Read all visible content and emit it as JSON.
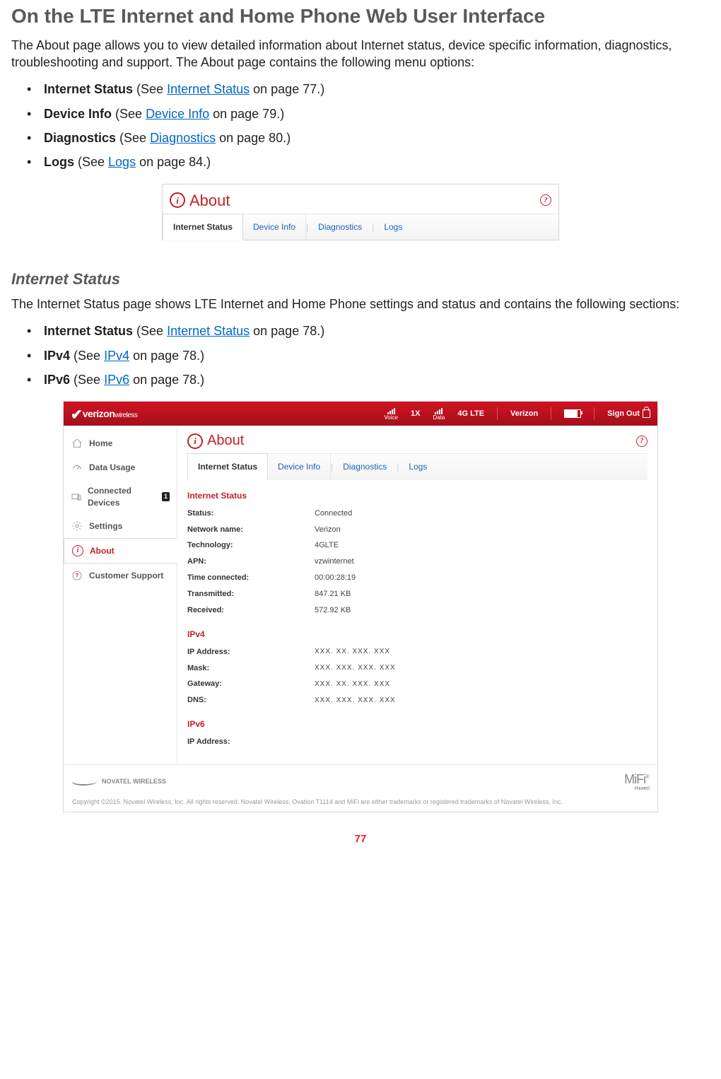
{
  "page": {
    "heading": "On the LTE Internet and Home Phone Web User Interface",
    "intro": "The About page allows you to view detailed information about Internet status, device specific information, diagnostics, troubleshooting and support. The About page contains the following menu options:",
    "bullets1": [
      {
        "bold": "Internet Status",
        "pre": " (See ",
        "link": "Internet Status",
        "post": " on page 77.)"
      },
      {
        "bold": "Device Info",
        "pre": " (See ",
        "link": "Device Info",
        "post": " on page 79.)"
      },
      {
        "bold": "Diagnostics",
        "pre": " (See ",
        "link": "Diagnostics",
        "post": " on page 80.)"
      },
      {
        "bold": "Logs",
        "pre": " (See ",
        "link": "Logs",
        "post": " on page 84.)"
      }
    ],
    "sub_heading": "Internet Status",
    "sub_intro": "The Internet Status page shows LTE Internet and Home Phone settings and status and contains the following sections:",
    "bullets2": [
      {
        "bold": "Internet Status",
        "pre": " (See ",
        "link": "Internet Status",
        "post": " on page 78.)"
      },
      {
        "bold": "IPv4",
        "pre": " (See ",
        "link": "IPv4",
        "post": " on page 78.)"
      },
      {
        "bold": "IPv6",
        "pre": " (See ",
        "link": "IPv6",
        "post": " on page 78.)"
      }
    ],
    "page_number": "77"
  },
  "small_panel": {
    "title": "About",
    "tabs": [
      "Internet Status",
      "Device Info",
      "Diagnostics",
      "Logs"
    ],
    "active_tab": "Internet Status"
  },
  "app": {
    "topbar": {
      "logo1": "verizon",
      "logo2": "wireless",
      "voice_label": "Voice",
      "voice_tech": "1X",
      "data_label": "Data",
      "data_tech": "4G LTE",
      "carrier": "Verizon",
      "signout": "Sign Out"
    },
    "sidebar": [
      {
        "label": "Home",
        "icon": "home-icon"
      },
      {
        "label": "Data Usage",
        "icon": "gauge-icon"
      },
      {
        "label": "Connected Devices",
        "icon": "devices-icon",
        "badge": "1"
      },
      {
        "label": "Settings",
        "icon": "gear-icon"
      },
      {
        "label": "About",
        "icon": "info-icon",
        "active": true
      },
      {
        "label": "Customer Support",
        "icon": "question-icon"
      }
    ],
    "content": {
      "title": "About",
      "tabs": [
        "Internet Status",
        "Device Info",
        "Diagnostics",
        "Logs"
      ],
      "active_tab": "Internet Status",
      "sections": {
        "internet_status": {
          "heading": "Internet Status",
          "rows": [
            {
              "k": "Status:",
              "v": "Connected"
            },
            {
              "k": "Network name:",
              "v": "Verizon"
            },
            {
              "k": "Technology:",
              "v": "4GLTE"
            },
            {
              "k": "APN:",
              "v": "vzwinternet"
            },
            {
              "k": "Time connected:",
              "v": "00:00:28:19"
            },
            {
              "k": "Transmitted:",
              "v": "847.21 KB"
            },
            {
              "k": "Received:",
              "v": "572.92 KB"
            }
          ]
        },
        "ipv4": {
          "heading": "IPv4",
          "rows": [
            {
              "k": "IP Address:",
              "v": "XXX. XX. XXX. XXX"
            },
            {
              "k": "Mask:",
              "v": "XXX. XXX. XXX. XXX"
            },
            {
              "k": "Gateway:",
              "v": "XXX. XX. XXX. XXX"
            },
            {
              "k": "DNS:",
              "v": "XXX. XXX. XXX. XXX"
            }
          ]
        },
        "ipv6": {
          "heading": "IPv6",
          "rows": [
            {
              "k": "IP Address:",
              "v": ""
            }
          ]
        }
      }
    },
    "footer": {
      "brand": "NOVATEL WIRELESS",
      "copyright": "Copyright ©2015. Novatel Wireless, Inc. All rights reserved. Novatel Wireless, Ovation T1114 and MiFi are either trademarks or registered trademarks of Novatel Wireless, Inc.",
      "mifi": "MiFi",
      "powered": "Powered"
    }
  }
}
